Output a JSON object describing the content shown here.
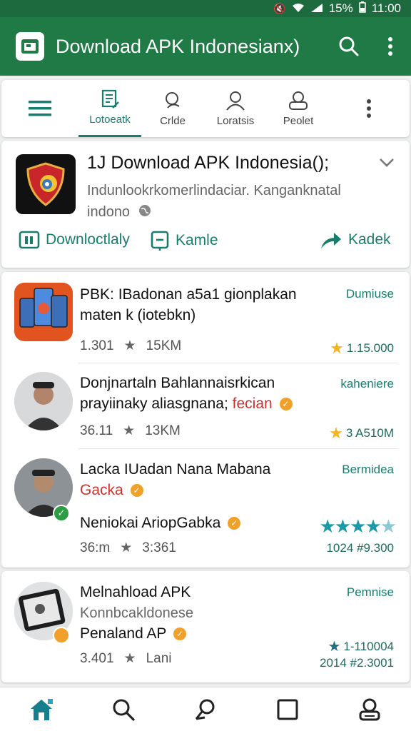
{
  "status": {
    "battery": "15%",
    "time": "11:00"
  },
  "appbar": {
    "title": "Download APK Indonesianx)"
  },
  "tabs": [
    {
      "label": "Lotoeatk",
      "icon": "document-icon",
      "active": true
    },
    {
      "label": "Crlde",
      "icon": "chat-icon",
      "active": false
    },
    {
      "label": "Loratsis",
      "icon": "person-icon",
      "active": false
    },
    {
      "label": "Peolet",
      "icon": "group-icon",
      "active": false
    }
  ],
  "featured": {
    "title": "1J Download APK Indonesia();",
    "desc_line1": "Indunlookrkomerlindaciar. Kanganknatal",
    "desc_line2": "indono",
    "action1": "Downloctlaly",
    "action2": "Kamle",
    "action3": "Kadek"
  },
  "list": [
    {
      "title1": "PBK: IBadonan a5a1 gionplakan",
      "title2": "maten k (iotebkn)",
      "rating": "1.301",
      "size": "15KM",
      "right_label": "Dumiuse",
      "right_value": "1.15.000"
    },
    {
      "title1": "Donjnartaln Bahlannaisrkican",
      "title2": "prayiinaky aliasgnana;",
      "title2_red": "fecian",
      "rating": "36.11",
      "size": "13KM",
      "right_label": "kaheniere",
      "right_value": "3 A510M"
    },
    {
      "title1": "Lacka IUadan Nana Mabana",
      "title2_red": "Gacka",
      "sub": "Neniokai AriopGabka",
      "rating": "36:m",
      "size": "3:361",
      "right_label": "Bermidea",
      "right_value": "1024 #9.300"
    }
  ],
  "bottom_card": {
    "title": "Melnahload APK",
    "sub": "Konnbcakldonese",
    "sub2": "Penaland AP",
    "rating": "3.401",
    "size": "Lani",
    "right_label": "Pemnise",
    "right_value1": "1-110004",
    "right_value2": "2014 #2.3001"
  },
  "bottomnav": [
    "home-icon",
    "search-icon",
    "chat-icon",
    "square-icon",
    "profile-icon"
  ],
  "colors": {
    "primary": "#1f7a45",
    "accent": "#177e6e",
    "star": "#f2b51d",
    "star_teal": "#1a9aa8"
  }
}
